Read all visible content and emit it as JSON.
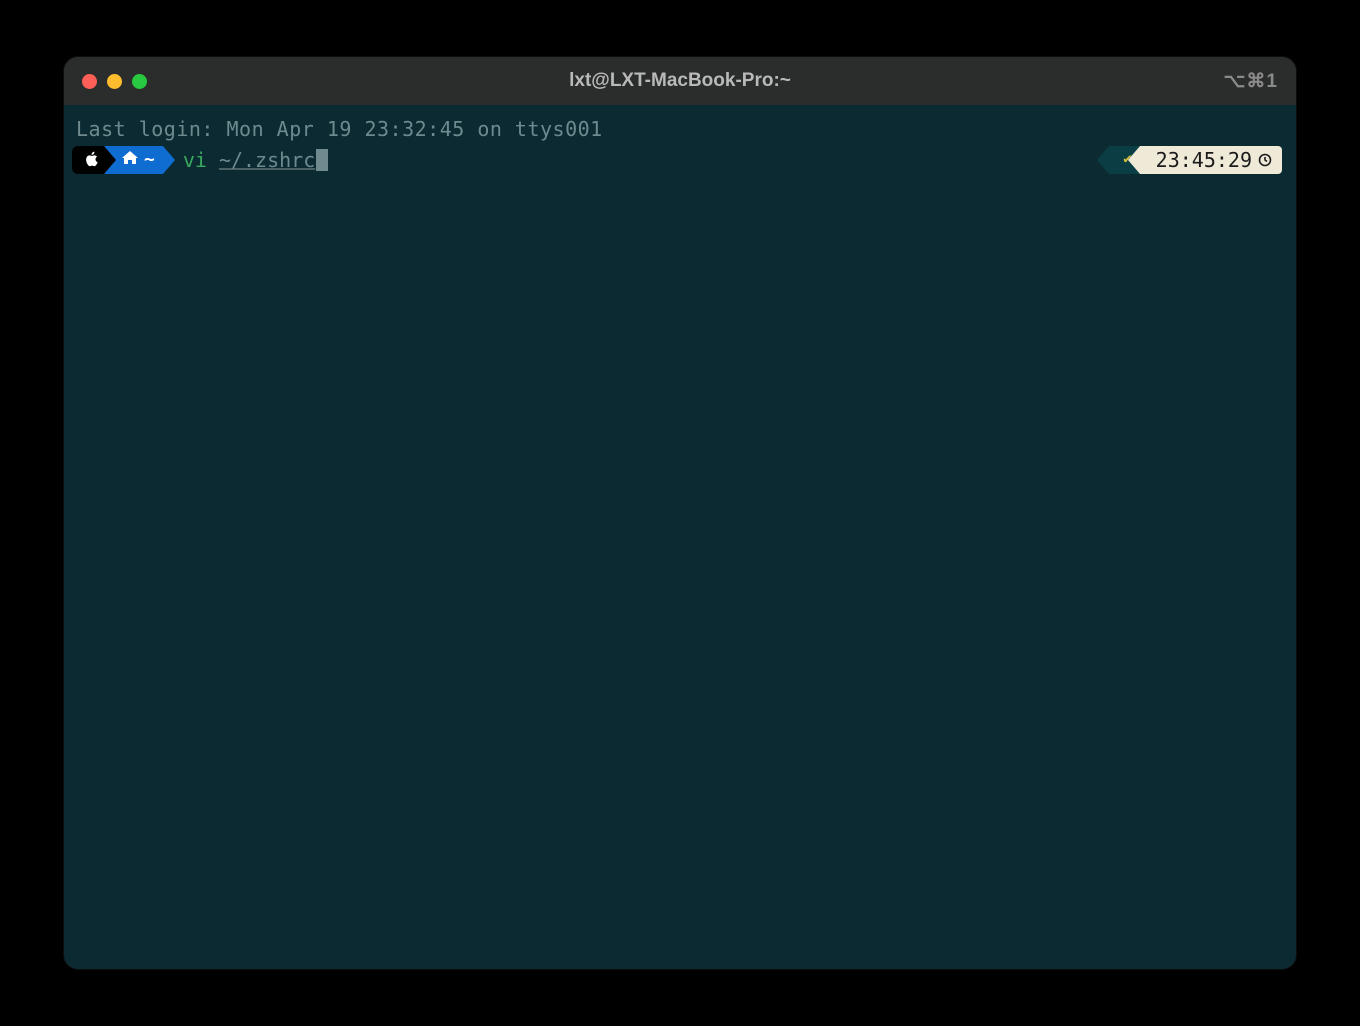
{
  "titlebar": {
    "title": "lxt@LXT-MacBook-Pro:~",
    "right_hint": "⌥⌘1"
  },
  "terminal": {
    "last_login": "Last login: Mon Apr 19 23:32:45 on ttys001",
    "prompt": {
      "os_segment_icon": "apple-icon",
      "path_segment_icon": "home-icon",
      "path_segment_text": "~"
    },
    "command": {
      "name": "vi",
      "arg": "~/.zshrc"
    },
    "status": {
      "ok_icon": "✔",
      "time": "23:45:29",
      "clock_icon": "clock-icon"
    }
  },
  "colors": {
    "window_bg": "#0b2a32",
    "titlebar_bg": "#2b2c2c",
    "seg_blue": "#0f6cd1",
    "seg_dark": "#0b3d44",
    "seg_cream": "#efe9d7",
    "cmd_green": "#3aa85f"
  }
}
